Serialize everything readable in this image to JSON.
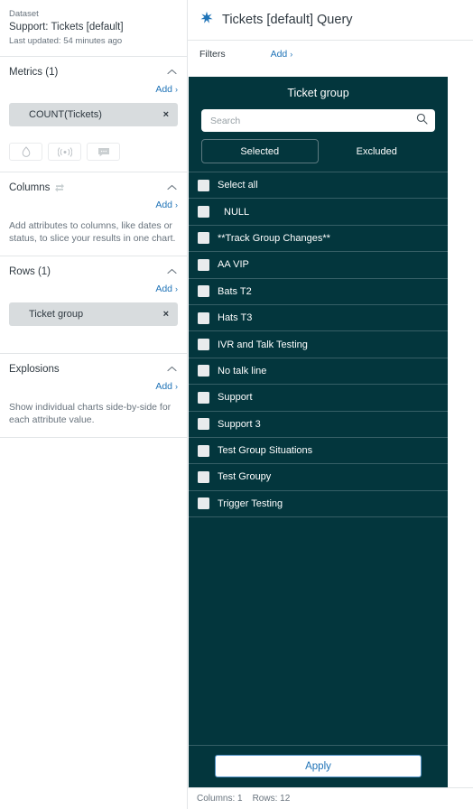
{
  "sidebar": {
    "dataset": {
      "label": "Dataset",
      "title": "Support: Tickets [default]",
      "updated": "Last updated: 54 minutes ago"
    },
    "metrics": {
      "title": "Metrics (1)",
      "add_label": "Add",
      "add_carat": "›",
      "collapse_icon": "chevron-up-icon",
      "chips": [
        {
          "label": "COUNT(Tickets)",
          "remove": "×"
        }
      ],
      "icon_buttons": [
        {
          "name": "droplet-icon"
        },
        {
          "name": "broadcast-icon"
        },
        {
          "name": "comment-icon"
        }
      ]
    },
    "columns": {
      "title": "Columns",
      "swap_icon": "swap-rows-columns-icon",
      "add_label": "Add",
      "add_carat": "›",
      "hint": "Add attributes to columns, like dates or status, to slice your results in one chart."
    },
    "rows": {
      "title": "Rows (1)",
      "add_label": "Add",
      "add_carat": "›",
      "chips": [
        {
          "label": "Ticket group",
          "remove": "×"
        }
      ]
    },
    "explosions": {
      "title": "Explosions",
      "add_label": "Add",
      "add_carat": "›",
      "hint": "Show individual charts side-by-side for each attribute value."
    }
  },
  "main": {
    "header": {
      "icon": "sparkle-star-icon",
      "title": "Tickets [default] Query"
    },
    "filters": {
      "label": "Filters",
      "add_label": "Add",
      "add_carat": "›"
    }
  },
  "dropdown": {
    "title": "Ticket group",
    "search": {
      "placeholder": "Search",
      "value": "",
      "icon": "search-icon"
    },
    "tabs": [
      {
        "label": "Selected",
        "active": true
      },
      {
        "label": "Excluded",
        "active": false
      }
    ],
    "options": [
      {
        "label": "Select all",
        "checked": false,
        "indent": false
      },
      {
        "label": "NULL",
        "checked": false,
        "indent": true
      },
      {
        "label": "**Track Group Changes**",
        "checked": false,
        "indent": false
      },
      {
        "label": "AA VIP",
        "checked": false,
        "indent": false
      },
      {
        "label": "Bats T2",
        "checked": false,
        "indent": false
      },
      {
        "label": "Hats T3",
        "checked": false,
        "indent": false
      },
      {
        "label": "IVR and Talk Testing",
        "checked": false,
        "indent": false
      },
      {
        "label": "No talk line",
        "checked": false,
        "indent": false
      },
      {
        "label": "Support",
        "checked": false,
        "indent": false
      },
      {
        "label": "Support 3",
        "checked": false,
        "indent": false
      },
      {
        "label": "Test Group Situations",
        "checked": false,
        "indent": false
      },
      {
        "label": "Test Groupy",
        "checked": false,
        "indent": false
      },
      {
        "label": "Trigger Testing",
        "checked": false,
        "indent": false
      }
    ],
    "apply_label": "Apply"
  },
  "statusbar": {
    "columns": "Columns: 1",
    "rows": "Rows: 12"
  },
  "colors": {
    "dark_panel": "#03363d",
    "accent_link": "#1f73b7",
    "chip_bg": "#d8dcde",
    "border": "#e3e6e8"
  }
}
